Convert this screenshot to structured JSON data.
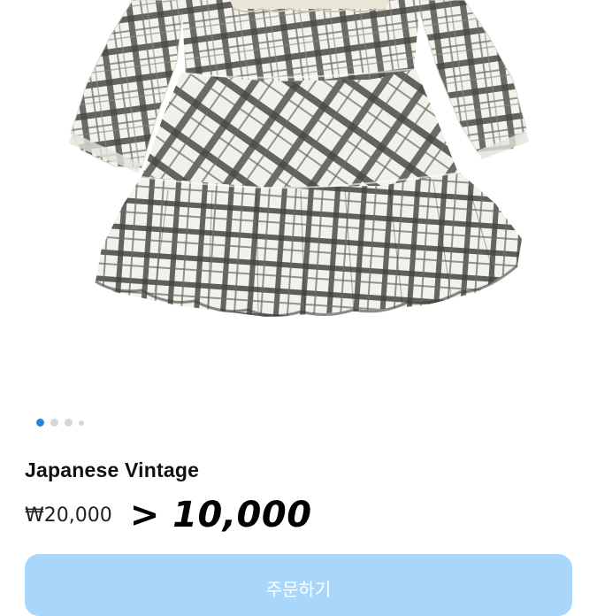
{
  "product": {
    "title": "Japanese Vintage",
    "original_price": "₩20,000",
    "sale_price": "> 10,000",
    "image_subject": "plaid tiered dress with lace collar"
  },
  "gallery": {
    "page_count": 4,
    "active_index": 0
  },
  "actions": {
    "order_label": "주문하기"
  },
  "colors": {
    "accent": "#1e88e5",
    "button_bg": "#a9d6fb",
    "plaid_dark": "#4a4a45",
    "plaid_light": "#f3f2ec"
  }
}
